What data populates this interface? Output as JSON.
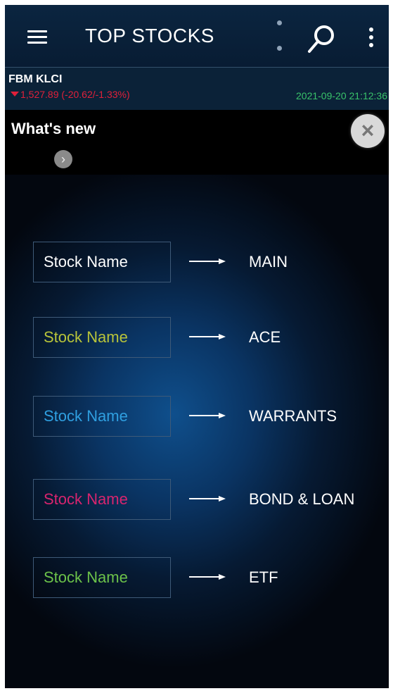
{
  "appbar": {
    "title": "TOP STOCKS",
    "icons": [
      "menu-icon",
      "swap-icon",
      "search-icon",
      "more-vertical-icon"
    ]
  },
  "ticker": {
    "name": "FBM KLCI",
    "value": "1,527.89 (-20.62/-1.33%)",
    "timestamp": "2021-09-20 21:12:36",
    "direction": "down",
    "colors": {
      "down": "#e0203a",
      "time": "#39c36a"
    }
  },
  "whats_new": {
    "title": "What's new"
  },
  "legend": [
    {
      "stock_label": "Stock Name",
      "color": "#ffffff",
      "board": "MAIN"
    },
    {
      "stock_label": "Stock Name",
      "color": "#b8c43a",
      "board": "ACE"
    },
    {
      "stock_label": "Stock Name",
      "color": "#2f9fe0",
      "board": "WARRANTS"
    },
    {
      "stock_label": "Stock Name",
      "color": "#d8246e",
      "board": "BOND & LOAN"
    },
    {
      "stock_label": "Stock Name",
      "color": "#6cc24a",
      "board": "ETF"
    }
  ]
}
